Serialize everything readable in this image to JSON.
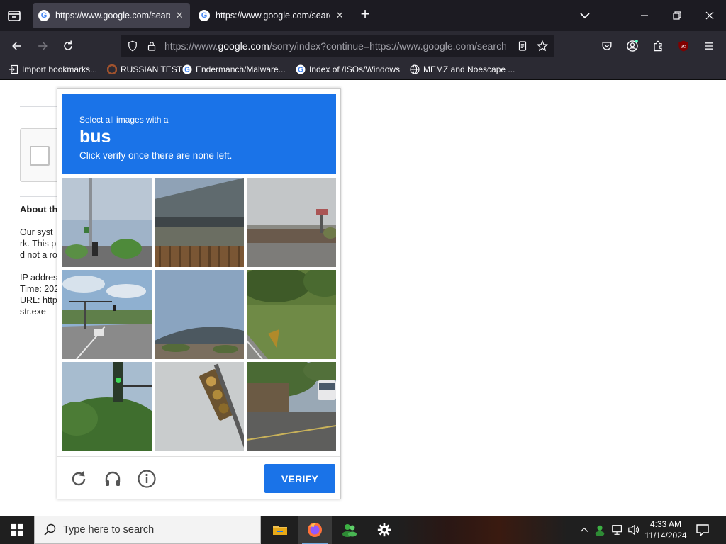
{
  "browser": {
    "tabs": [
      {
        "title": "https://www.google.com/search",
        "active": true
      },
      {
        "title": "https://www.google.com/search",
        "active": false
      }
    ],
    "url": {
      "prefix": "https://www.",
      "domain": "google.com",
      "rest": "/sorry/index?continue=https://www.google.com/search"
    },
    "bookmarks": [
      {
        "label": "Import bookmarks...",
        "icon": "import-icon"
      },
      {
        "label": "RUSSIAN TEST",
        "icon": "bookmark-favicon"
      },
      {
        "label": "Endermanch/Malware...",
        "icon": "google-favicon"
      },
      {
        "label": "Index of /ISOs/Windows",
        "icon": "google-favicon"
      },
      {
        "label": "MEMZ and Noescape ...",
        "icon": "globe-icon"
      }
    ]
  },
  "page": {
    "about_heading": "About th",
    "paragraph_lines": [
      "Our syst",
      "rk. This p",
      "d not a ro"
    ],
    "info_lines": [
      "IP addres",
      "Time: 202",
      "URL: http",
      "str.exe"
    ]
  },
  "captcha": {
    "instruction_line1": "Select all images with a",
    "target_word": "bus",
    "instruction_line2": "Click verify once there are none left.",
    "verify_label": "VERIFY",
    "accent_color": "#1a73e8",
    "footer_icons": [
      "reload-icon",
      "audio-icon",
      "info-icon"
    ]
  },
  "taskbar": {
    "search_placeholder": "Type here to search",
    "time": "4:33 AM",
    "date": "11/14/2024"
  }
}
